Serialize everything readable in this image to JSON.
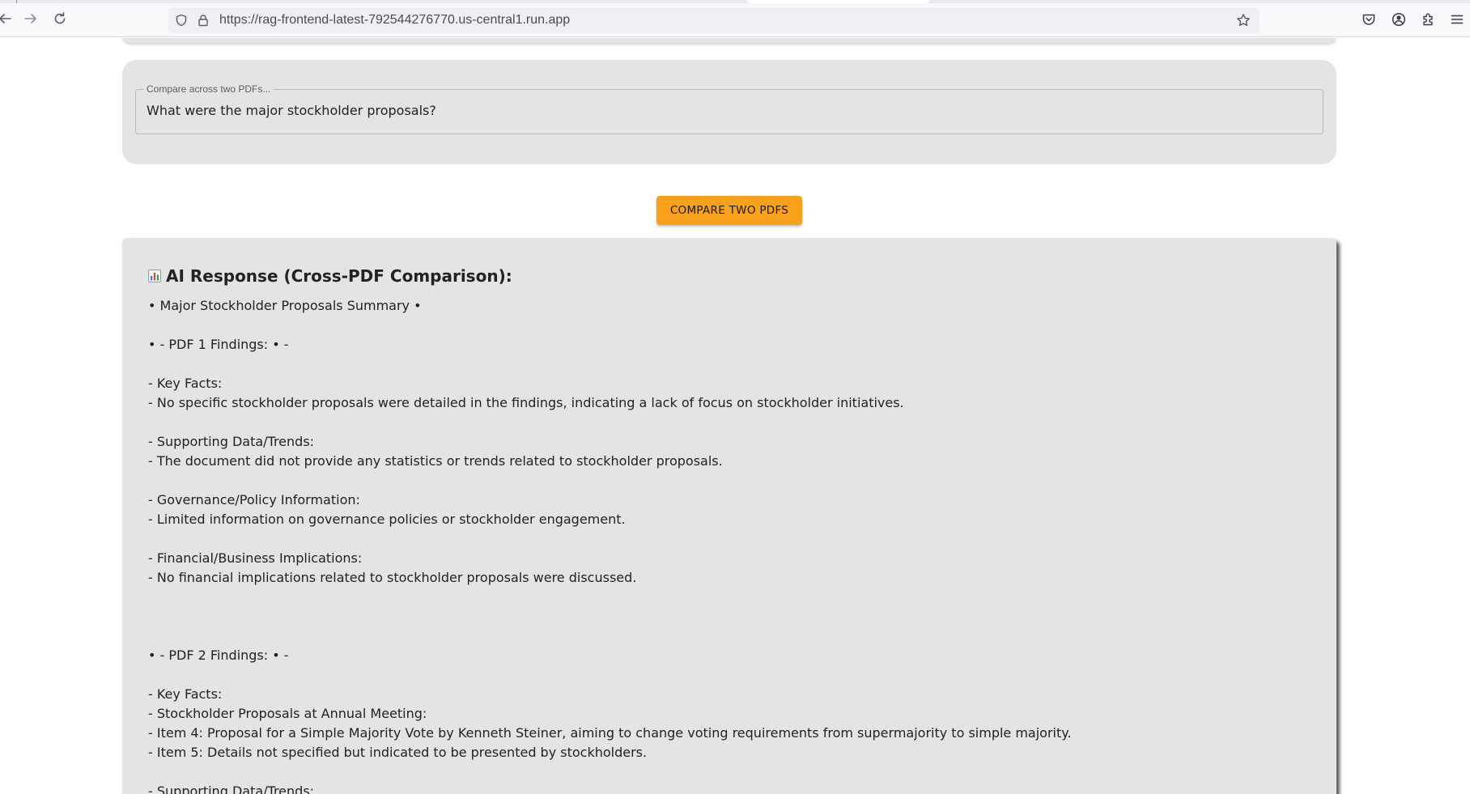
{
  "browser": {
    "url": "https://rag-frontend-latest-792544276770.us-central1.run.app",
    "icons": {
      "back": "back-arrow-icon",
      "forward": "forward-arrow-icon",
      "reload": "reload-icon",
      "tracking": "tracking-protection-shield-icon",
      "lock": "lock-icon",
      "bookmark": "bookmark-star-icon",
      "pocket": "pocket-icon",
      "account": "account-icon",
      "extensions": "extensions-icon",
      "menu": "hamburger-menu-icon"
    }
  },
  "query": {
    "label": "Compare across two PDFs...",
    "value": "What were the major stockholder proposals?"
  },
  "compare_button": {
    "label": "COMPARE TWO PDFS"
  },
  "response": {
    "title": "AI Response (Cross-PDF Comparison):",
    "title_icon": "bar-chart-icon",
    "lines": [
      "• Major Stockholder Proposals Summary •",
      "",
      "• - PDF 1 Findings: • -",
      "",
      "- Key Facts:",
      "- No specific stockholder proposals were detailed in the findings, indicating a lack of focus on stockholder initiatives.",
      "",
      "- Supporting Data/Trends:",
      "- The document did not provide any statistics or trends related to stockholder proposals.",
      "",
      "- Governance/Policy Information:",
      "- Limited information on governance policies or stockholder engagement.",
      "",
      "- Financial/Business Implications:",
      "- No financial implications related to stockholder proposals were discussed.",
      "",
      "",
      "",
      "• - PDF 2 Findings: • -",
      "",
      "- Key Facts:",
      "- Stockholder Proposals at Annual Meeting:",
      "- Item 4: Proposal for a Simple Majority Vote by Kenneth Steiner, aiming to change voting requirements from supermajority to simple majority.",
      "- Item 5: Details not specified but indicated to be presented by stockholders.",
      "",
      "- Supporting Data/Trends:"
    ]
  },
  "colors": {
    "accent_button": "#f9a11b",
    "card_background": "#e4e4e4",
    "text": "#222222"
  }
}
